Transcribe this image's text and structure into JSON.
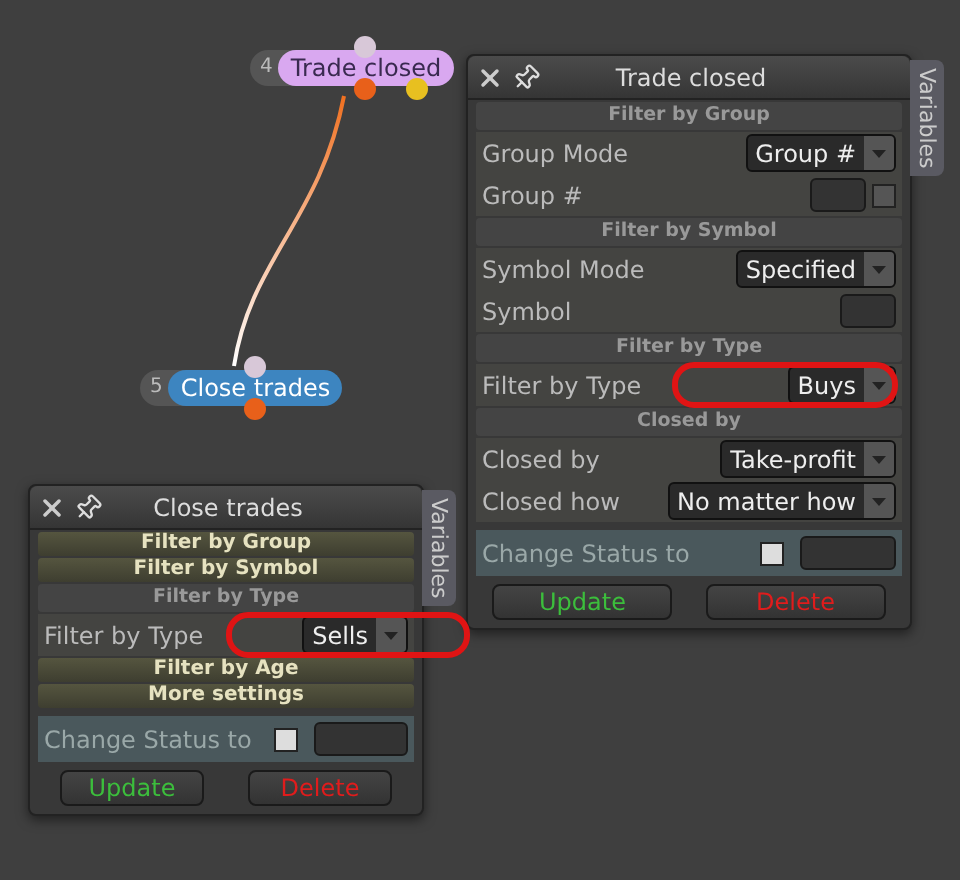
{
  "nodes": [
    {
      "number": "4",
      "label": "Trade closed",
      "color": "#d9a8f0"
    },
    {
      "number": "5",
      "label": "Close trades",
      "color": "#3d85c0"
    }
  ],
  "panels": [
    {
      "title": "Trade closed",
      "side_tab": "Variables",
      "groups": [
        {
          "title": "Filter by Group",
          "expanded": true,
          "rows": [
            {
              "label": "Group Mode",
              "control": {
                "kind": "dropdown",
                "value": "Group #"
              }
            },
            {
              "label": "Group #",
              "control": {
                "kind": "field_checkbox",
                "checked": false
              }
            }
          ]
        },
        {
          "title": "Filter by Symbol",
          "expanded": true,
          "rows": [
            {
              "label": "Symbol Mode",
              "control": {
                "kind": "dropdown",
                "value": "Specified"
              }
            },
            {
              "label": "Symbol",
              "control": {
                "kind": "field"
              }
            }
          ]
        },
        {
          "title": "Filter by Type",
          "expanded": true,
          "rows": [
            {
              "label": "Filter by Type",
              "highlighted": true,
              "control": {
                "kind": "dropdown",
                "value": "Buys"
              }
            }
          ]
        },
        {
          "title": "Closed by",
          "expanded": true,
          "rows": [
            {
              "label": "Closed by",
              "control": {
                "kind": "dropdown",
                "value": "Take-profit"
              }
            },
            {
              "label": "Closed how",
              "control": {
                "kind": "dropdown",
                "value": "No matter how"
              }
            }
          ]
        }
      ],
      "status": {
        "label": "Change Status to",
        "checked": false
      },
      "buttons": [
        {
          "label": "Update",
          "kind": "update"
        },
        {
          "label": "Delete",
          "kind": "delete"
        }
      ]
    },
    {
      "title": "Close trades",
      "side_tab": "Variables",
      "groups": [
        {
          "title": "Filter by Group",
          "expanded": false
        },
        {
          "title": "Filter by Symbol",
          "expanded": false
        },
        {
          "title": "Filter by Type",
          "expanded": true,
          "rows": [
            {
              "label": "Filter by Type",
              "highlighted": true,
              "control": {
                "kind": "dropdown",
                "value": "Sells"
              }
            }
          ]
        },
        {
          "title": "Filter by Age",
          "expanded": false
        },
        {
          "title": "More settings",
          "expanded": false
        }
      ],
      "status": {
        "label": "Change Status to",
        "checked": false
      },
      "buttons": [
        {
          "label": "Update",
          "kind": "update"
        },
        {
          "label": "Delete",
          "kind": "delete"
        }
      ]
    }
  ]
}
